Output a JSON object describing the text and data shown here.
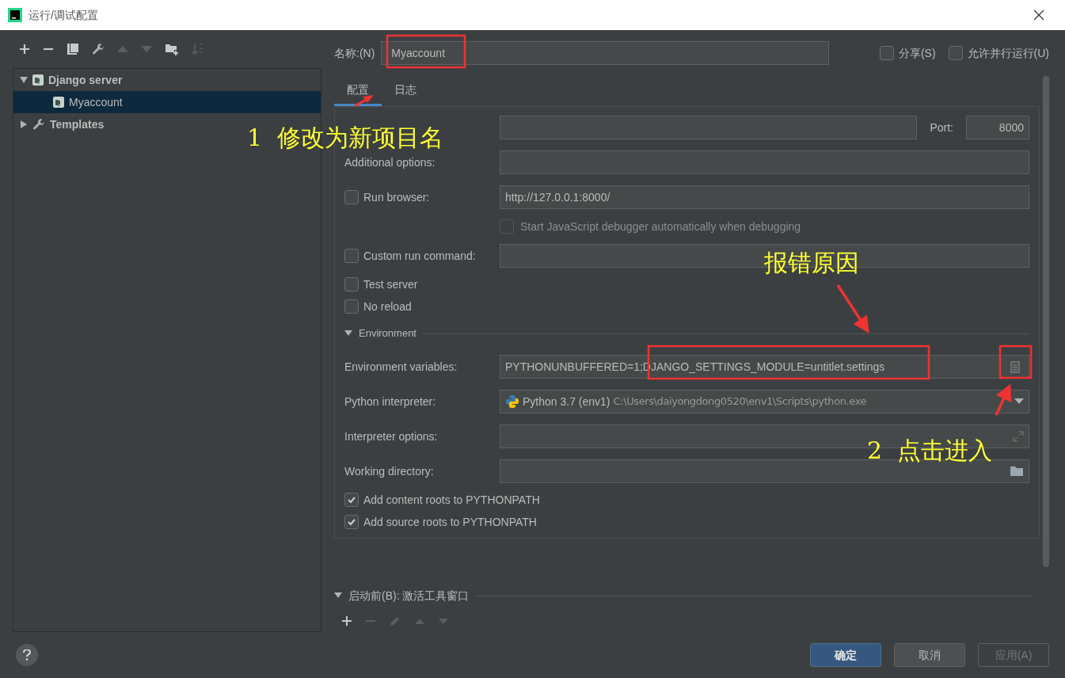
{
  "window": {
    "title": "运行/调试配置"
  },
  "tree": [
    {
      "label": "Django server",
      "kind": "django",
      "expanded": true,
      "selected": false,
      "children": [
        {
          "label": "Myaccount",
          "kind": "django",
          "selected": true
        }
      ]
    },
    {
      "label": "Templates",
      "kind": "wrench",
      "expanded": false,
      "selected": false
    }
  ],
  "name_field": {
    "label": "名称:(N)",
    "value": "Myaccount"
  },
  "options": [
    {
      "label": "分享(S)",
      "checked": false
    },
    {
      "label": "允许并行运行(U)",
      "checked": false
    }
  ],
  "tabs": [
    {
      "label": "配置",
      "selected": true
    },
    {
      "label": "日志",
      "selected": false
    }
  ],
  "host": {
    "port_label": "Port:",
    "port": "8000"
  },
  "rows": [
    {
      "kind": "text",
      "label": "Additional options:",
      "value": ""
    },
    {
      "kind": "check_input",
      "label": "Run browser:",
      "checked": false,
      "value": "http://127.0.0.1:8000/"
    },
    {
      "kind": "sub_check",
      "label": "Start JavaScript debugger automatically when debugging",
      "checked": false,
      "disabled": true
    },
    {
      "kind": "check_input",
      "label": "Custom run command:",
      "checked": false,
      "value": ""
    },
    {
      "kind": "check",
      "label": "Test server",
      "checked": false
    },
    {
      "kind": "check",
      "label": "No reload",
      "checked": false
    },
    {
      "kind": "section",
      "label": "Environment",
      "expanded": true
    },
    {
      "kind": "env",
      "label": "Environment variables:",
      "value": "PYTHONUNBUFFERED=1;DJANGO_SETTINGS_MODULE=untitlet.settings"
    },
    {
      "kind": "interpreter",
      "label": "Python interpreter:",
      "value": "Python 3.7 (env1)",
      "path": "C:\\Users\\daiyongdong0520\\env1\\Scripts\\python.exe"
    },
    {
      "kind": "expand",
      "label": "Interpreter options:",
      "value": ""
    },
    {
      "kind": "folder",
      "label": "Working directory:",
      "value": ""
    },
    {
      "kind": "check",
      "label": "Add content roots to PYTHONPATH",
      "checked": true
    },
    {
      "kind": "check",
      "label": "Add source roots to PYTHONPATH",
      "checked": true
    }
  ],
  "before_launch": {
    "title": "启动前(B): 激活工具窗口",
    "expanded": true
  },
  "buttons": [
    {
      "label": "确定",
      "kind": "primary"
    },
    {
      "label": "取消",
      "kind": "normal"
    },
    {
      "label": "应用(A)",
      "kind": "disabled"
    }
  ],
  "annotations": [
    {
      "text": "1  修改为新项目名"
    },
    {
      "text": "报错原因"
    },
    {
      "text": "2  点击进入"
    }
  ]
}
